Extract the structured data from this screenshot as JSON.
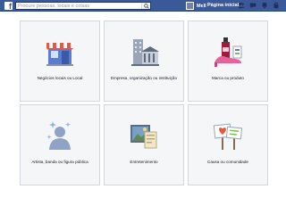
{
  "topbar": {
    "logo": "f",
    "search_placeholder": "Procure pessoas, locais e coisas",
    "user_name": "Mell",
    "home_label": "Página inicial",
    "icons": [
      "friends-icon",
      "messages-icon",
      "notifications-icon",
      "privacy-icon"
    ]
  },
  "categories": [
    {
      "label": "Negócios locais ou Local",
      "icon": "storefront-icon"
    },
    {
      "label": "Empresa, organização ou instituição",
      "icon": "building-icon"
    },
    {
      "label": "Marca ou produto",
      "icon": "products-icon"
    },
    {
      "label": "Artista, banda ou figura pública",
      "icon": "public-figure-icon"
    },
    {
      "label": "Entretenimento",
      "icon": "entertainment-icon"
    },
    {
      "label": "Causa ou comunidade",
      "icon": "cause-signs-icon"
    }
  ],
  "colors": {
    "brand": "#3b5998",
    "card_bg": "#f5f6f7",
    "card_border": "#d3d6db"
  }
}
